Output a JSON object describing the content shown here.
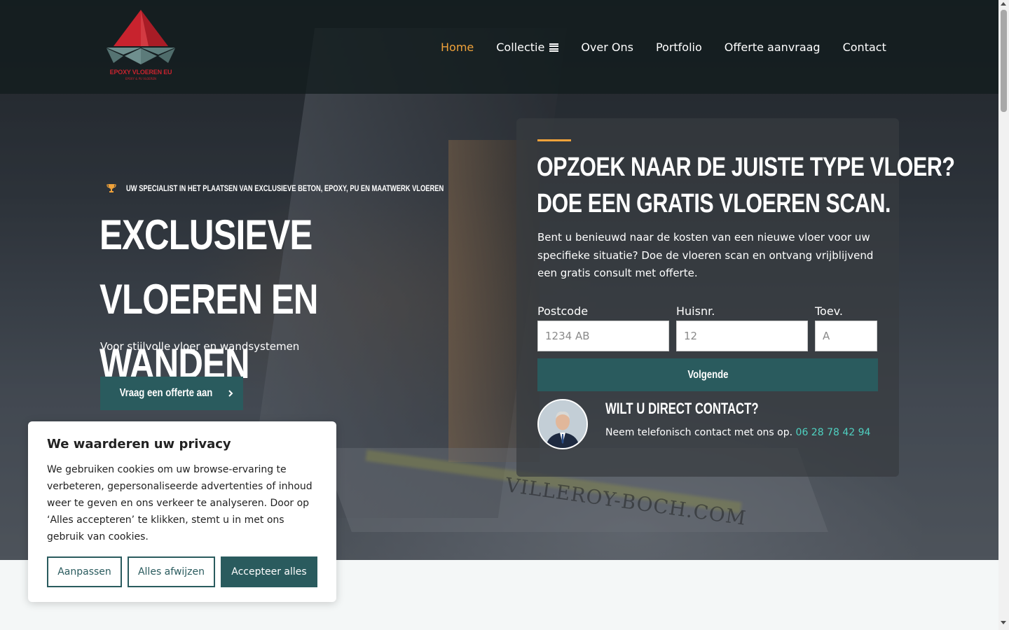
{
  "brand": {
    "logo_text": "EPOXY VLOEREN EU",
    "logo_subtext": "EPOXY & PU VLOEREN"
  },
  "nav": {
    "items": [
      {
        "label": "Home",
        "active": true
      },
      {
        "label": "Collectie",
        "active": false,
        "icon": "menu-icon"
      },
      {
        "label": "Over Ons",
        "active": false
      },
      {
        "label": "Portfolio",
        "active": false
      },
      {
        "label": "Offerte aanvraag",
        "active": false
      },
      {
        "label": "Contact",
        "active": false
      }
    ]
  },
  "hero": {
    "badge_icon": "trophy-icon",
    "badge": "Uw specialist in het plaatsen van exclusieve beton, epoxy, PU en maatwerk vloeren",
    "title": "Exclusieve vloeren en wanden",
    "subtitle": "Voor stijlvolle vloer en wandsystemen",
    "cta_label": "Vraag een offerte aan",
    "background_watermark": "VILLEROY-BOCH.COM"
  },
  "scan_card": {
    "title_line1": "Opzoek naar de juiste type vloer?",
    "title_line2": "Doe een gratis vloeren scan.",
    "description": "Bent u benieuwd naar de kosten van een nieuwe vloer voor uw specifieke situatie? Doe de vloeren scan en ontvang vrijblijvend een gratis consult met offerte.",
    "fields": {
      "postcode": {
        "label": "Postcode",
        "placeholder": "1234 AB",
        "value": ""
      },
      "huisnr": {
        "label": "Huisnr.",
        "placeholder": "12",
        "value": ""
      },
      "toev": {
        "label": "Toev.",
        "placeholder": "A",
        "value": ""
      }
    },
    "next_label": "Volgende",
    "contact_title": "Wilt u direct contact?",
    "contact_text": "Neem telefonisch contact met ons op.",
    "phone": "06 28 78 42 94"
  },
  "cookie_banner": {
    "title": "We waarderen uw privacy",
    "text": "We gebruiken cookies om uw browse-ervaring te verbeteren, gepersonaliseerde advertenties of inhoud weer te geven en ons verkeer te analyseren. Door op ‘Alles accepteren’ te klikken, stemt u in met ons gebruik van cookies.",
    "customize_label": "Aanpassen",
    "reject_label": "Alles afwijzen",
    "accept_label": "Accepteer alles"
  },
  "colors": {
    "primary": "#2a5b5e",
    "accent": "#f0a23a",
    "link": "#4fd1c1",
    "logo_red": "#c8232e"
  }
}
